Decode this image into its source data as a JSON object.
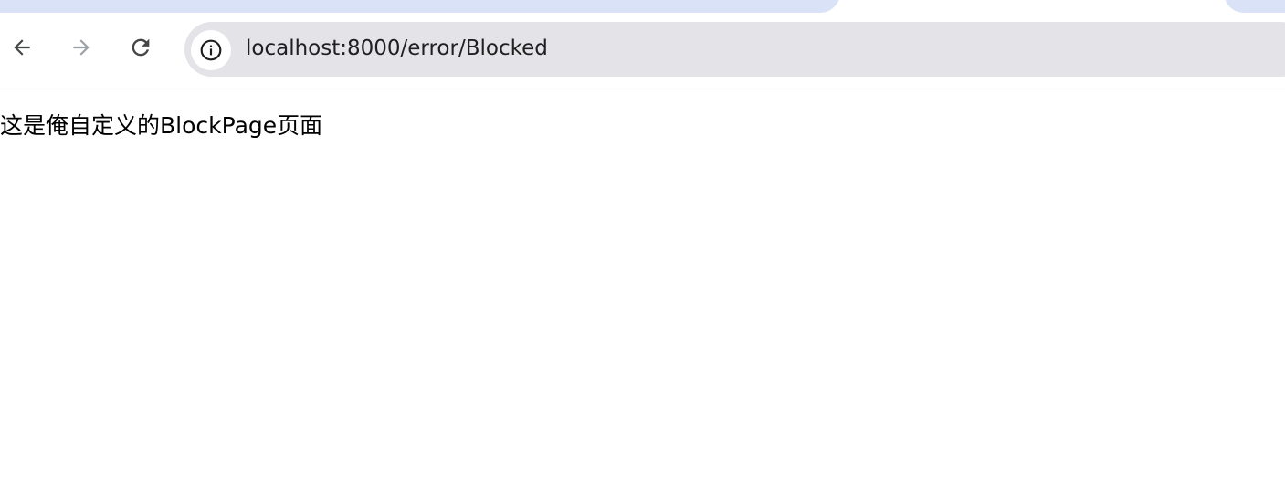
{
  "browser": {
    "toolbar": {
      "back_icon": "arrow-left-icon",
      "forward_icon": "arrow-right-icon",
      "reload_icon": "reload-icon"
    },
    "address_bar": {
      "site_info_icon": "info-icon",
      "url": "localhost:8000/error/Blocked"
    }
  },
  "page": {
    "message": "这是俺自定义的BlockPage页面"
  },
  "colors": {
    "tab_active": "#d9e2f7",
    "omnibox_bg": "#e3e3e8",
    "icon_active": "#444746",
    "icon_disabled": "#9aa0a6"
  }
}
